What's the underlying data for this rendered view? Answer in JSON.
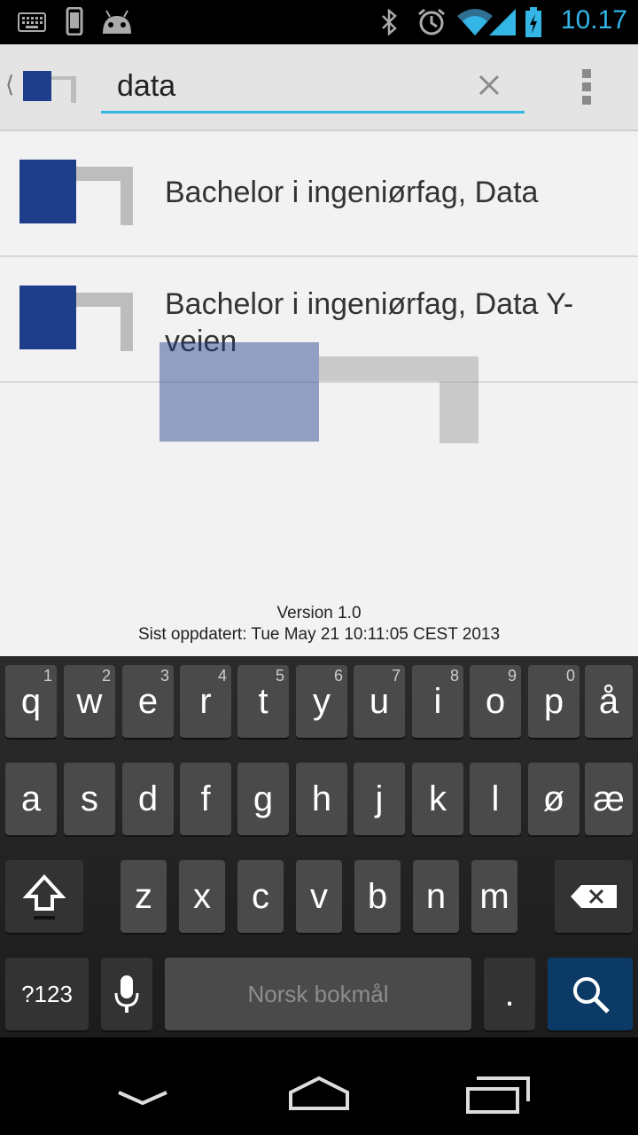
{
  "status_bar": {
    "time": "10.17",
    "icons": [
      "keyboard-icon",
      "phone-icon",
      "android-icon",
      "bluetooth-icon",
      "alarm-icon",
      "wifi-icon",
      "signal-icon",
      "battery-icon"
    ],
    "accent_color": "#33b5e5"
  },
  "action_bar": {
    "search_value": "data",
    "icons": [
      "up-chevron-icon",
      "app-logo-icon",
      "clear-icon",
      "overflow-menu-icon"
    ]
  },
  "results": [
    {
      "title": "Bachelor i ingeniørfag, Data"
    },
    {
      "title": "Bachelor i ingeniørfag, Data Y-veien"
    }
  ],
  "footer": {
    "version": "Version 1.0",
    "updated": "Sist oppdatert: Tue May 21 10:11:05 CEST 2013"
  },
  "keyboard": {
    "row1": [
      {
        "ch": "q",
        "hint": "1"
      },
      {
        "ch": "w",
        "hint": "2"
      },
      {
        "ch": "e",
        "hint": "3"
      },
      {
        "ch": "r",
        "hint": "4"
      },
      {
        "ch": "t",
        "hint": "5"
      },
      {
        "ch": "y",
        "hint": "6"
      },
      {
        "ch": "u",
        "hint": "7"
      },
      {
        "ch": "i",
        "hint": "8"
      },
      {
        "ch": "o",
        "hint": "9"
      },
      {
        "ch": "p",
        "hint": "0"
      },
      {
        "ch": "å",
        "hint": ""
      }
    ],
    "row2": [
      "a",
      "s",
      "d",
      "f",
      "g",
      "h",
      "j",
      "k",
      "l",
      "ø",
      "æ"
    ],
    "row3": [
      "z",
      "x",
      "c",
      "v",
      "b",
      "n",
      "m"
    ],
    "symbols_label": "?123",
    "space_label": "Norsk bokmål",
    "period_label": ".",
    "brand_colors": {
      "logo_blue": "#1e3d8a",
      "logo_gray": "#bdbdbd"
    }
  },
  "nav_bar": {
    "icons": [
      "back-icon",
      "home-icon",
      "recents-icon"
    ]
  }
}
